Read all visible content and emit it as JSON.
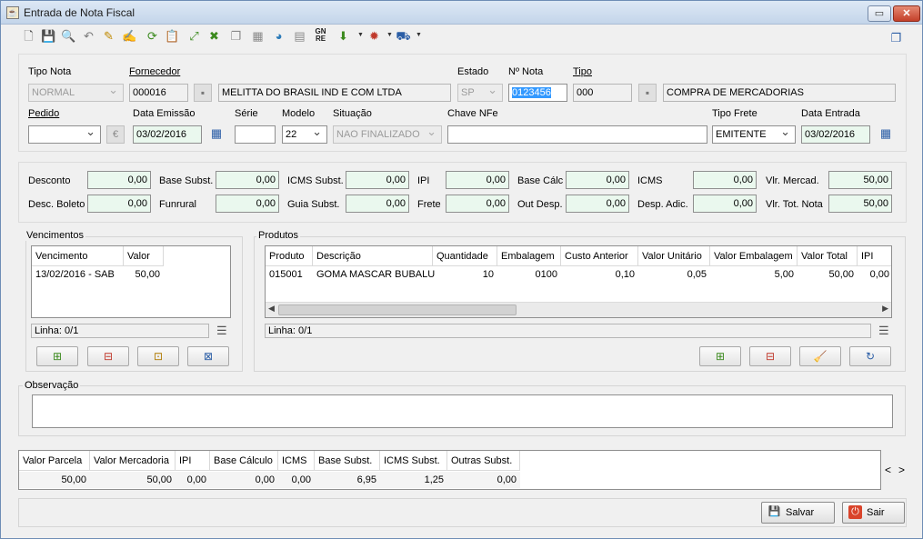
{
  "window": {
    "title": "Entrada de Nota Fiscal",
    "controls": {
      "restore": "▭",
      "close": "✕"
    }
  },
  "toolbar": {
    "icons": [
      {
        "name": "new-document-icon",
        "glyph": "🗋",
        "color": "#555555"
      },
      {
        "name": "save-icon",
        "glyph": "💾",
        "color": "#1f4e9c"
      },
      {
        "name": "search-icon",
        "glyph": "🔍",
        "color": "#2b5ea6"
      },
      {
        "name": "undo-icon",
        "glyph": "↶",
        "color": "#7a7a7a"
      },
      {
        "name": "magic-wand-icon",
        "glyph": "✎",
        "color": "#c08a00"
      },
      {
        "name": "edit-icon",
        "glyph": "✍",
        "color": "#b07a00"
      },
      {
        "name": "refresh-icon",
        "glyph": "⟳",
        "color": "#3b8a1e"
      },
      {
        "name": "paste-icon",
        "glyph": "📋",
        "color": "#8a6a2a"
      },
      {
        "name": "expand-icon",
        "glyph": "⤢",
        "color": "#3b8a1e"
      },
      {
        "name": "shrink-icon",
        "glyph": "✖",
        "color": "#3b8a1e"
      },
      {
        "name": "copy-icon",
        "glyph": "❐",
        "color": "#8a8a8a"
      },
      {
        "name": "print-icon",
        "glyph": "▦",
        "color": "#8a8a8a"
      },
      {
        "name": "globe-user-icon",
        "glyph": "◕",
        "color": "#2a7ab8"
      },
      {
        "name": "calculator-icon",
        "glyph": "▤",
        "color": "#8a8a8a"
      },
      {
        "name": "gnre-icon",
        "glyph": "GN\nRE",
        "color": "#1b1b1b"
      },
      {
        "name": "download-icon",
        "glyph": "⬇",
        "color": "#3b8a1e"
      },
      {
        "name": "stamp-icon",
        "glyph": "✹",
        "color": "#c0392b"
      },
      {
        "name": "truck-icon",
        "glyph": "⛟",
        "color": "#2b5ea6"
      }
    ],
    "right_icon": "copy-windows-icon"
  },
  "header": {
    "tipo_nota_label": "Tipo Nota",
    "tipo_nota_value": "NORMAL",
    "fornecedor_label": "Fornecedor",
    "fornecedor_code": "000016",
    "fornecedor_name": "MELITTA DO BRASIL IND E COM LTDA",
    "estado_label": "Estado",
    "estado_value": "SP",
    "nota_label": "Nº Nota",
    "nota_value": "0123456",
    "tipo_label": "Tipo",
    "tipo_code": "000",
    "tipo_desc": "COMPRA DE MERCADORIAS",
    "pedido_label": "Pedido",
    "pedido_value": "",
    "data_emissao_label": "Data Emissão",
    "data_emissao_value": "03/02/2016",
    "serie_label": "Série",
    "serie_value": "",
    "modelo_label": "Modelo",
    "modelo_value": "22",
    "situacao_label": "Situação",
    "situacao_value": "NAO FINALIZADO",
    "chave_label": "Chave NFe",
    "chave_value": "",
    "tipo_frete_label": "Tipo Frete",
    "tipo_frete_value": "EMITENTE",
    "data_entrada_label": "Data Entrada",
    "data_entrada_value": "03/02/2016"
  },
  "totals": {
    "desconto_label": "Desconto",
    "desconto": "0,00",
    "base_subst_label": "Base Subst.",
    "base_subst": "0,00",
    "icms_subst_label": "ICMS Subst.",
    "icms_subst": "0,00",
    "ipi_label": "IPI",
    "ipi": "0,00",
    "base_calc_label": "Base Cálc",
    "base_calc": "0,00",
    "icms_label": "ICMS",
    "icms": "0,00",
    "vlr_mercad_label": "Vlr. Mercad.",
    "vlr_mercad": "50,00",
    "desc_boleto_label": "Desc. Boleto",
    "desc_boleto": "0,00",
    "funrural_label": "Funrural",
    "funrural": "0,00",
    "guia_subst_label": "Guia Subst.",
    "guia_subst": "0,00",
    "frete_label": "Frete",
    "frete": "0,00",
    "out_desp_label": "Out Desp.",
    "out_desp": "0,00",
    "desp_adic_label": "Desp. Adic.",
    "desp_adic": "0,00",
    "vlr_tot_nota_label": "Vlr. Tot. Nota",
    "vlr_tot_nota": "50,00"
  },
  "vencimentos": {
    "title": "Vencimentos",
    "columns": [
      "Vencimento",
      "Valor"
    ],
    "rows": [
      [
        "13/02/2016 - SAB",
        "50,00"
      ]
    ],
    "status": "Linha: 0/1"
  },
  "produtos": {
    "title": "Produtos",
    "columns": [
      "Produto",
      "Descrição",
      "Quantidade",
      "Embalagem",
      "Custo Anterior",
      "Valor Unitário",
      "Valor Embalagem",
      "Valor Total",
      "IPI"
    ],
    "rows": [
      [
        "015001",
        "GOMA MASCAR BUBALU",
        "10",
        "0100",
        "0,10",
        "0,05",
        "5,00",
        "50,00",
        "0,00"
      ]
    ],
    "status": "Linha: 0/1"
  },
  "observacao": {
    "label": "Observação",
    "value": ""
  },
  "summary": {
    "columns": [
      "Valor Parcela",
      "Valor Mercadoria",
      "IPI",
      "Base Cálculo",
      "ICMS",
      "Base Subst.",
      "ICMS Subst.",
      "Outras Subst."
    ],
    "values": [
      "50,00",
      "50,00",
      "0,00",
      "0,00",
      "0,00",
      "6,95",
      "1,25",
      "0,00"
    ],
    "nav_prev": "<",
    "nav_next": ">"
  },
  "buttons": {
    "salvar": "Salvar",
    "sair": "Sair"
  }
}
